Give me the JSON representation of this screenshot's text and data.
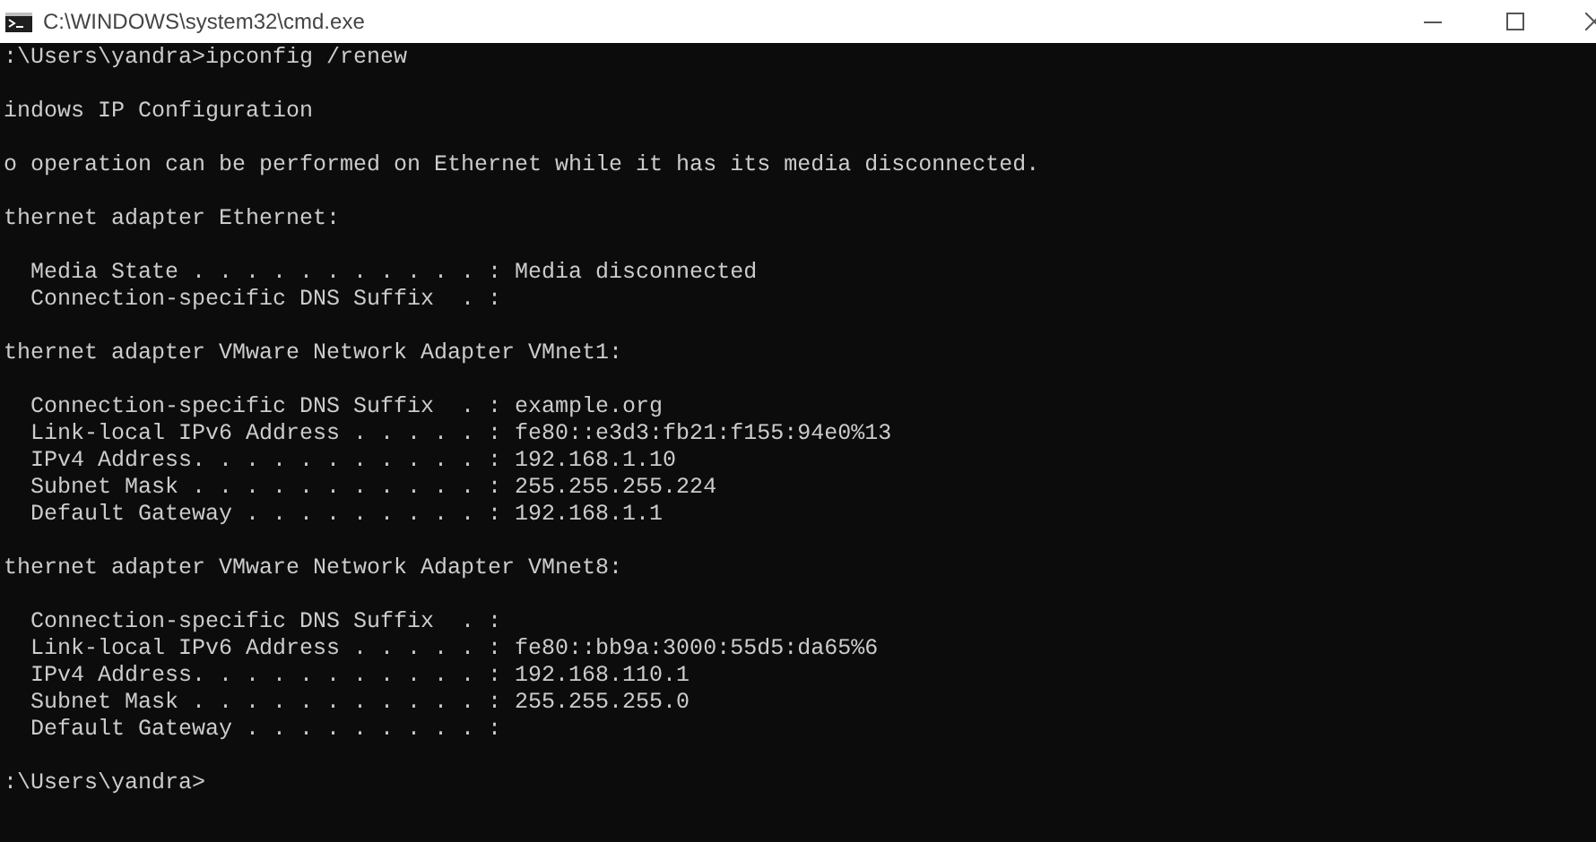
{
  "window": {
    "title": "C:\\WINDOWS\\system32\\cmd.exe"
  },
  "console": {
    "lines": [
      {
        "kind": "text",
        "text": ":\\Users\\yandra>ipconfig /renew"
      },
      {
        "kind": "blank"
      },
      {
        "kind": "text",
        "text": "indows IP Configuration"
      },
      {
        "kind": "blank"
      },
      {
        "kind": "text",
        "text": "o operation can be performed on Ethernet while it has its media disconnected."
      },
      {
        "kind": "blank"
      },
      {
        "kind": "text",
        "text": "thernet adapter Ethernet:"
      },
      {
        "kind": "blank"
      },
      {
        "kind": "text",
        "text": "  Media State . . . . . . . . . . . : Media disconnected"
      },
      {
        "kind": "text",
        "text": "  Connection-specific DNS Suffix  . :"
      },
      {
        "kind": "blank"
      },
      {
        "kind": "text",
        "text": "thernet adapter VMware Network Adapter VMnet1:"
      },
      {
        "kind": "blank"
      },
      {
        "kind": "text",
        "text": "  Connection-specific DNS Suffix  . : example.org"
      },
      {
        "kind": "text",
        "text": "  Link-local IPv6 Address . . . . . : fe80::e3d3:fb21:f155:94e0%13"
      },
      {
        "kind": "text",
        "text": "  IPv4 Address. . . . . . . . . . . : 192.168.1.10"
      },
      {
        "kind": "text",
        "text": "  Subnet Mask . . . . . . . . . . . : 255.255.255.224"
      },
      {
        "kind": "text",
        "text": "  Default Gateway . . . . . . . . . : 192.168.1.1"
      },
      {
        "kind": "blank"
      },
      {
        "kind": "text",
        "text": "thernet adapter VMware Network Adapter VMnet8:"
      },
      {
        "kind": "blank"
      },
      {
        "kind": "text",
        "text": "  Connection-specific DNS Suffix  . :"
      },
      {
        "kind": "text",
        "text": "  Link-local IPv6 Address . . . . . : fe80::bb9a:3000:55d5:da65%6"
      },
      {
        "kind": "text",
        "text": "  IPv4 Address. . . . . . . . . . . : 192.168.110.1"
      },
      {
        "kind": "text",
        "text": "  Subnet Mask . . . . . . . . . . . : 255.255.255.0"
      },
      {
        "kind": "text",
        "text": "  Default Gateway . . . . . . . . . :"
      },
      {
        "kind": "blank"
      },
      {
        "kind": "text",
        "text": ":\\Users\\yandra>"
      }
    ]
  }
}
